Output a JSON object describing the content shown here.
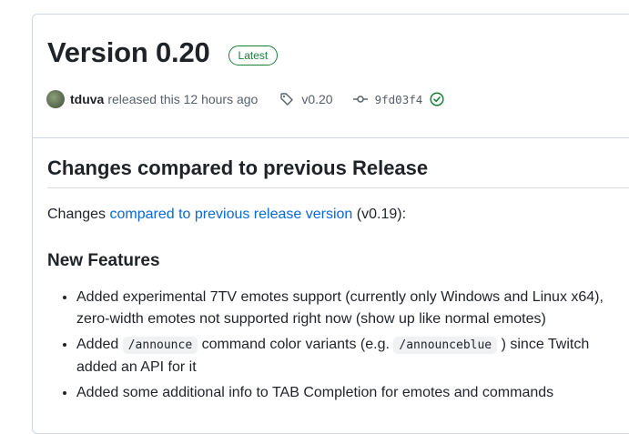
{
  "release": {
    "title": "Version 0.20",
    "badge": "Latest",
    "author": "tduva",
    "released_text": "released this 12 hours ago",
    "tag": "v0.20",
    "commit": "9fd03f4"
  },
  "body": {
    "heading": "Changes compared to previous Release",
    "intro_prefix": "Changes",
    "intro_link": "compared to previous release version",
    "intro_suffix": "(v0.19):",
    "features_heading": "New Features",
    "feature1": "Added experimental 7TV emotes support (currently only Windows and Linux x64), zero-width emotes not supported right now (show up like normal emotes)",
    "feature2_a": "Added",
    "feature2_code1": "/announce",
    "feature2_b": "command color variants (e.g.",
    "feature2_code2": "/announceblue",
    "feature2_c": ") since Twitch added an API for it",
    "feature3": "Added some additional info to TAB Completion for emotes and commands"
  },
  "colors": {
    "link": "#0969da",
    "badge": "#1a7f37",
    "border": "#d0d7de"
  },
  "icons": {
    "tag": "tag-icon",
    "commit": "git-commit-icon",
    "verified": "verified-check-icon"
  }
}
